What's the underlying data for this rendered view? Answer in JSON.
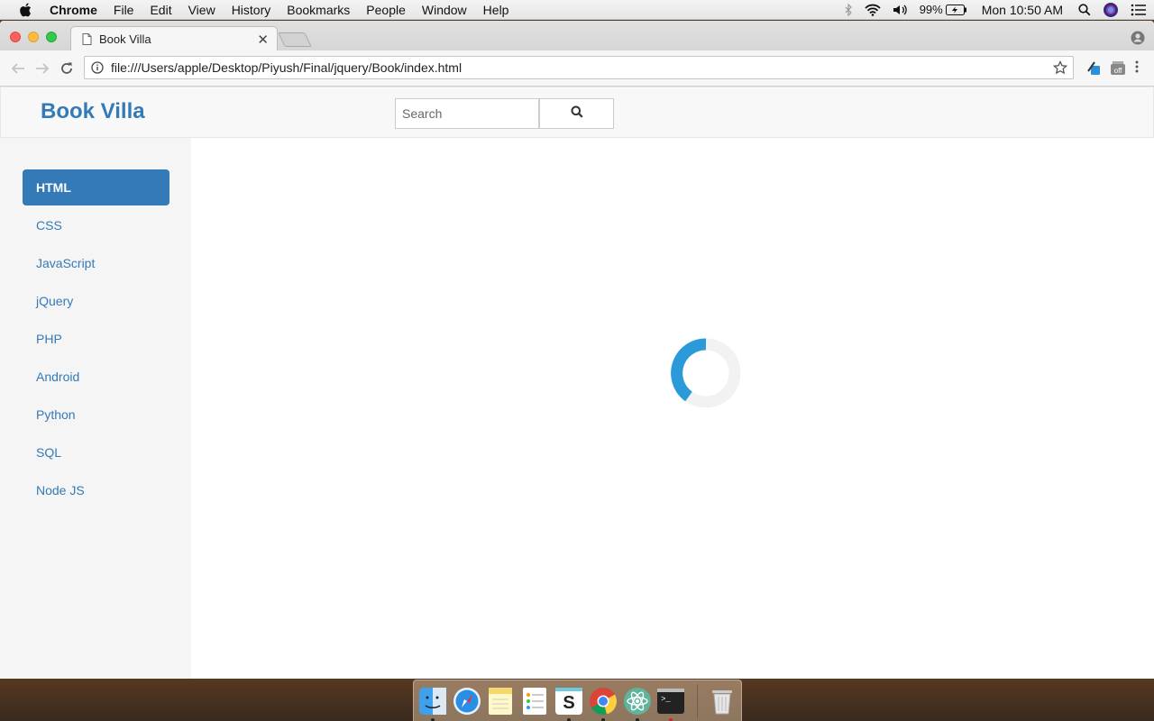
{
  "menubar": {
    "app_name": "Chrome",
    "items": [
      "File",
      "Edit",
      "View",
      "History",
      "Bookmarks",
      "People",
      "Window",
      "Help"
    ],
    "battery": "99%",
    "clock": "Mon 10:50 AM"
  },
  "browser": {
    "tab_title": "Book Villa",
    "url": "file:///Users/apple/Desktop/Piyush/Final/jquery/Book/index.html"
  },
  "site": {
    "brand": "Book Villa",
    "search": {
      "placeholder": "Search",
      "value": ""
    },
    "sidebar": {
      "items": [
        {
          "label": "HTML",
          "active": true
        },
        {
          "label": "CSS",
          "active": false
        },
        {
          "label": "JavaScript",
          "active": false
        },
        {
          "label": "jQuery",
          "active": false
        },
        {
          "label": "PHP",
          "active": false
        },
        {
          "label": "Android",
          "active": false
        },
        {
          "label": "Python",
          "active": false
        },
        {
          "label": "SQL",
          "active": false
        },
        {
          "label": "Node JS",
          "active": false
        }
      ]
    },
    "loading": true
  },
  "colors": {
    "brand": "#337ab7",
    "spinner_arc": "#2a9bd8",
    "spinner_track": "#f2f2f2"
  },
  "dock": {
    "apps": [
      "finder-icon",
      "safari-icon",
      "notes-icon",
      "reminders-icon",
      "slack-icon",
      "chrome-icon",
      "atom-icon",
      "terminal-icon",
      "trash-icon"
    ]
  }
}
